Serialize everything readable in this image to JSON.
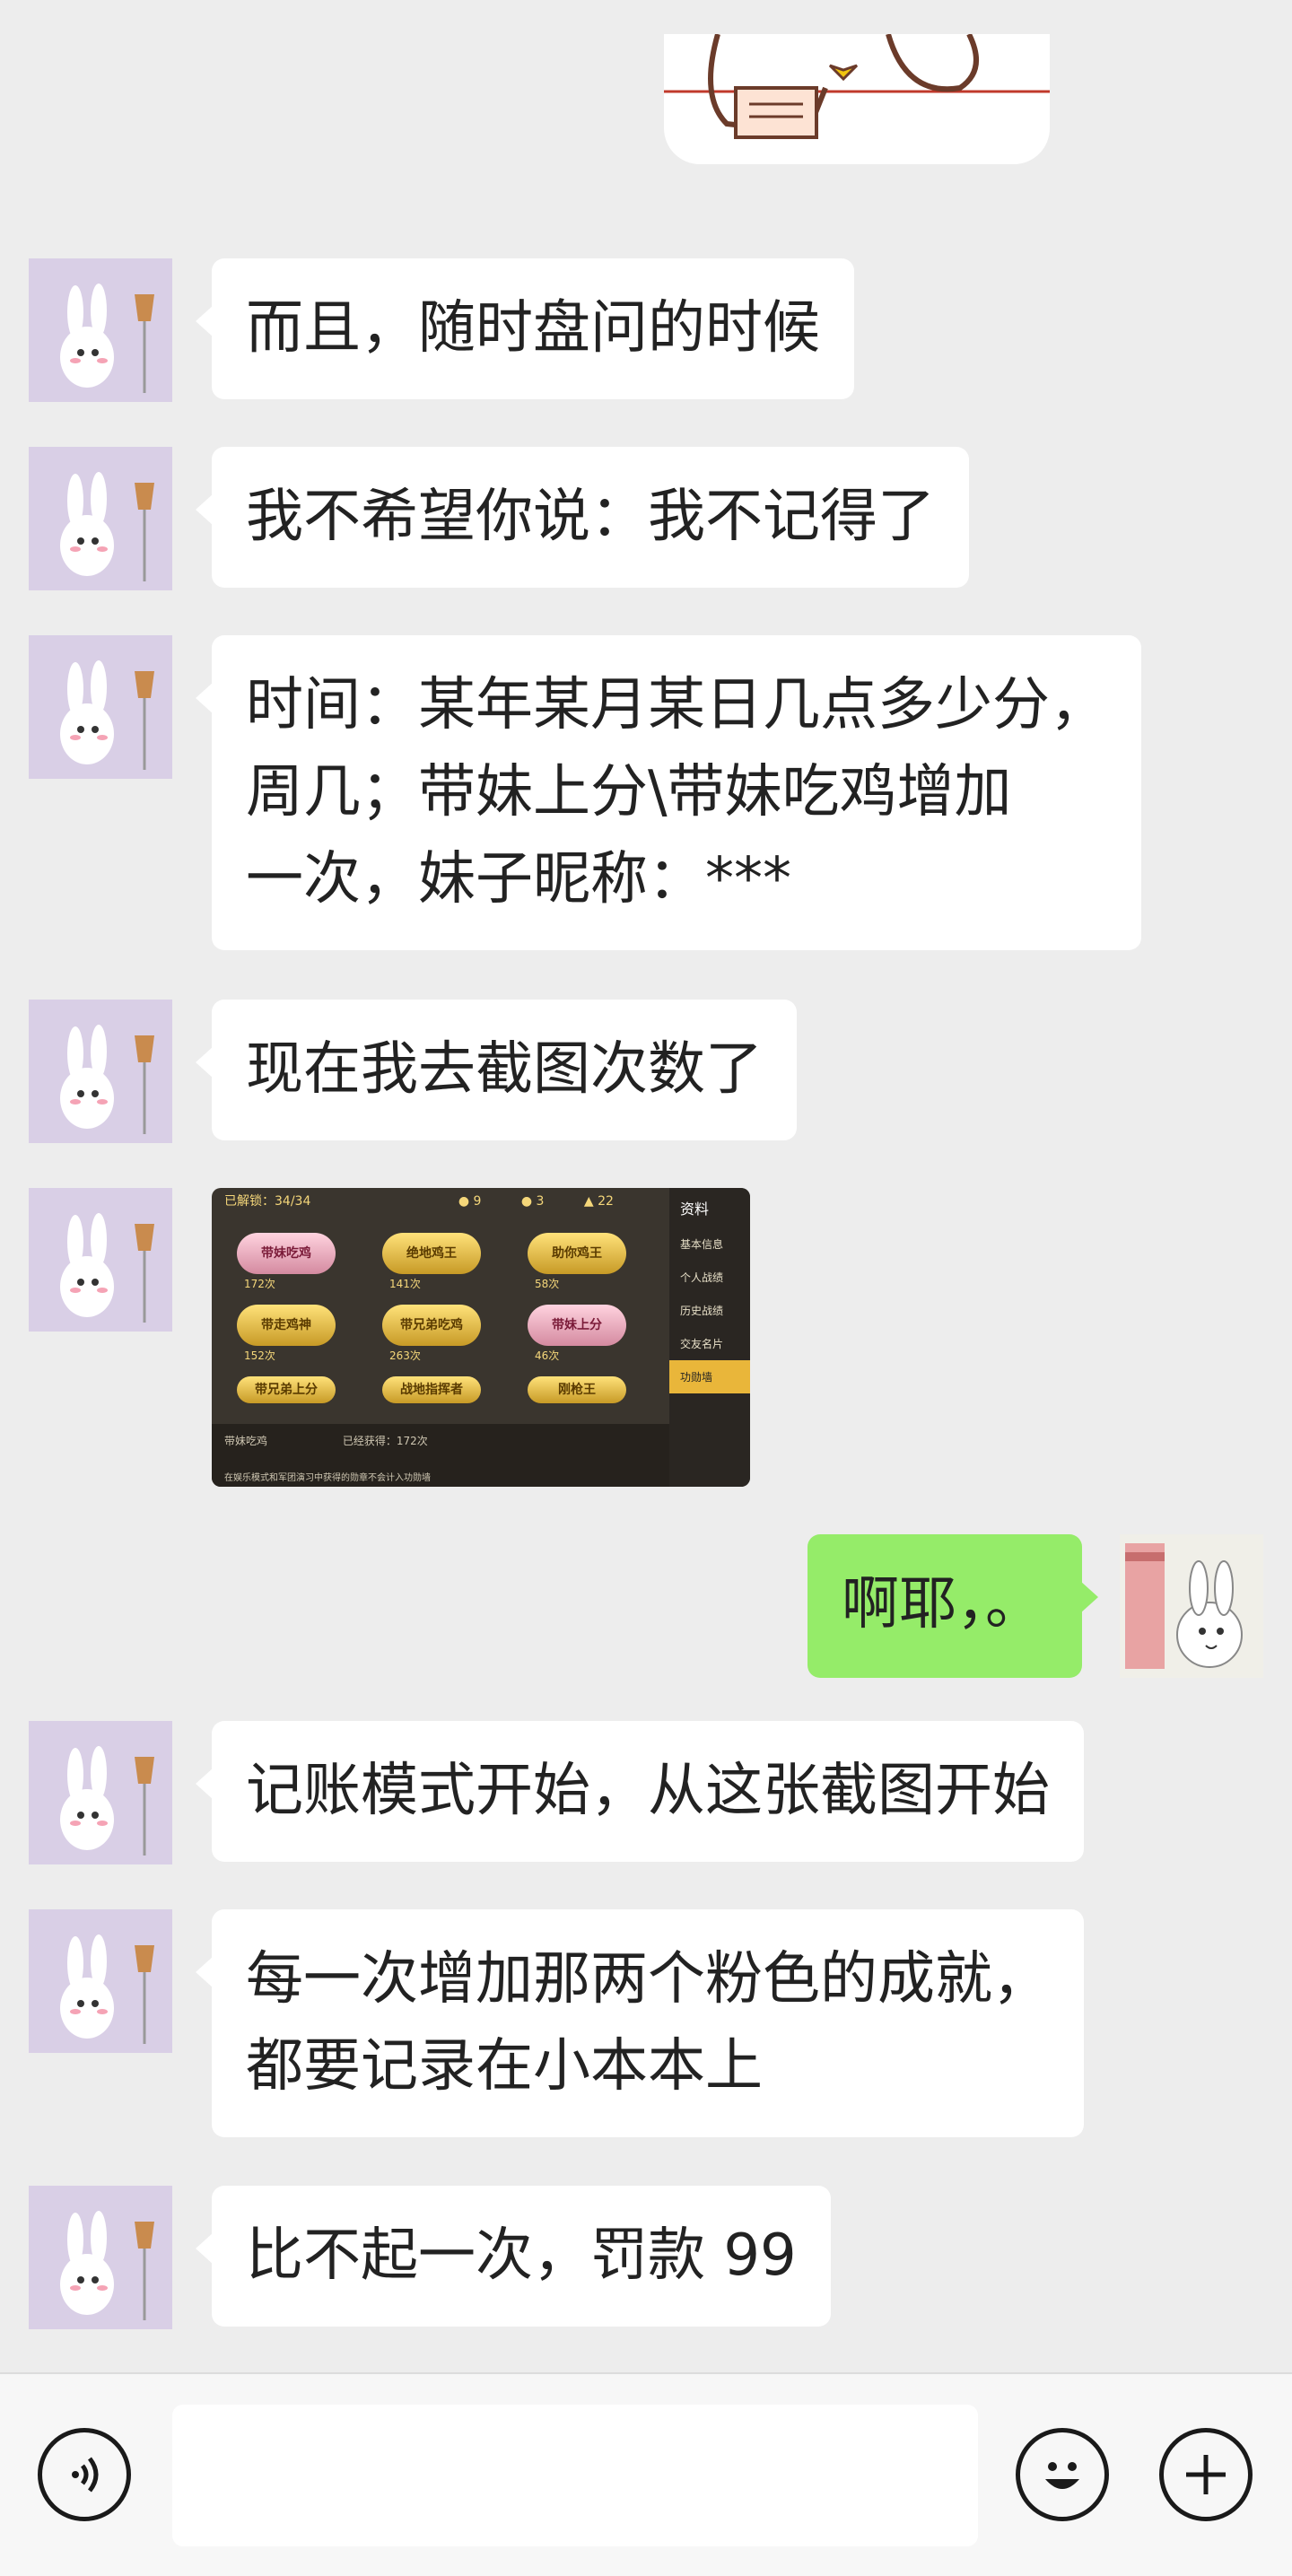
{
  "top_sticker": {
    "icon": "cat-sticker"
  },
  "messages": [
    {
      "side": "left",
      "text_lines": [
        "而且，随时盘问的时候"
      ]
    },
    {
      "side": "left",
      "text_lines": [
        "我不希望你说：我不记得了"
      ]
    },
    {
      "side": "left",
      "text_lines": [
        "时间：某年某月某日几点多少分，",
        "周几；带妹上分\\带妹吃鸡增加",
        "一次，妹子昵称：***"
      ]
    },
    {
      "side": "left",
      "text_lines": [
        "现在我去截图次数了"
      ]
    },
    {
      "side": "left",
      "type": "image",
      "image": {
        "header": "已解锁：34/34",
        "stats": [
          "9",
          "3",
          "22"
        ],
        "panel_title": "资料",
        "sidebar": [
          "基本信息",
          "个人战绩",
          "历史战绩",
          "交友名片",
          "功勋墙"
        ],
        "active_sidebar": "功勋墙",
        "badges": [
          {
            "label": "带妹吃鸡",
            "count": "172次",
            "color": "pink"
          },
          {
            "label": "绝地鸡王",
            "count": "141次",
            "color": "gold"
          },
          {
            "label": "助你鸡王",
            "count": "58次",
            "color": "gold"
          },
          {
            "label": "带走鸡神",
            "count": "152次",
            "color": "gold"
          },
          {
            "label": "带兄弟吃鸡",
            "count": "263次",
            "color": "gold"
          },
          {
            "label": "带妹上分",
            "count": "46次",
            "color": "pink"
          },
          {
            "label": "带兄弟上分",
            "count": "",
            "color": "gold"
          },
          {
            "label": "战地指挥者",
            "count": "",
            "color": "gold"
          },
          {
            "label": "刚枪王",
            "count": "",
            "color": "gold"
          }
        ],
        "footer_title": "带妹吃鸡",
        "footer_count": "已经获得：172次",
        "footer_desc": "在娱乐模式和军团演习中获得的勋章不会计入功勋墙"
      }
    },
    {
      "side": "right",
      "text_lines": [
        "啊耶，。"
      ]
    },
    {
      "side": "left",
      "text_lines": [
        "记账模式开始，从这张截图开始"
      ]
    },
    {
      "side": "left",
      "text_lines": [
        "每一次增加那两个粉色的成就，",
        "都要记录在小本本上"
      ]
    },
    {
      "side": "left",
      "text_lines": [
        "比不起一次，罚款 99"
      ]
    }
  ],
  "input_bar": {
    "voice_icon": "voice-icon",
    "input_value": "",
    "emoji_icon": "emoji-icon",
    "plus_icon": "plus-icon"
  }
}
